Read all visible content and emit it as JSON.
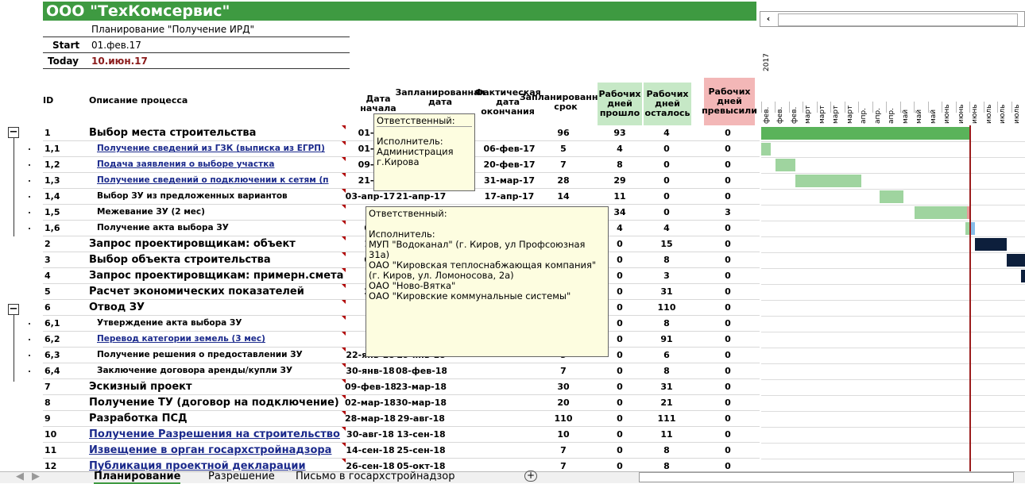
{
  "header": {
    "company": "ООО \"ТехКомсервис\"",
    "subtitle": "Планирование \"Получение ИРД\"",
    "start_label": "Start",
    "start_value": "01.фев.17",
    "today_label": "Today",
    "today_value": "10.июн.17",
    "year": "2017"
  },
  "columns": {
    "id": "ID",
    "desc": "Описание процесса",
    "start": "Дата начала",
    "plan": "Запланированная дата",
    "fact": "Фактическая дата окончания",
    "term": "Запланированный срок",
    "passed": "Рабочих дней прошло",
    "left": "Рабочих дней осталось",
    "over": "Рабочих дней превысили"
  },
  "months": [
    "фев.",
    "фев.",
    "фев.",
    "март",
    "март",
    "март",
    "март",
    "апр.",
    "апр.",
    "апр.",
    "май",
    "май",
    "май",
    "июнь",
    "июнь",
    "июнь",
    "июль",
    "июль",
    "июль"
  ],
  "rows": [
    {
      "id": "1",
      "desc": "Выбор места строительства",
      "start": "01-ф",
      "plan": "7",
      "fact": "",
      "term": "96",
      "passed": "93",
      "left": "4",
      "over": "0",
      "style": "big"
    },
    {
      "id": "1,1",
      "desc": "Получение сведений из ГЗК (выписка из ЕГРП)",
      "start": "01-ф",
      "plan": "7",
      "fact": "06-фев-17",
      "term": "5",
      "passed": "4",
      "left": "0",
      "over": "0",
      "style": "link"
    },
    {
      "id": "1,2",
      "desc": "Подача заявления о выборе участка",
      "start": "09-ф",
      "plan": "7",
      "fact": "20-фев-17",
      "term": "7",
      "passed": "8",
      "left": "0",
      "over": "0",
      "style": "link"
    },
    {
      "id": "1,3",
      "desc": "Получение сведений о подключении к сетям (п",
      "start": "21-ф",
      "plan": "7",
      "fact": "31-мар-17",
      "term": "28",
      "passed": "29",
      "left": "0",
      "over": "0",
      "style": "link"
    },
    {
      "id": "1,4",
      "desc": "Выбор ЗУ из предложенных вариантов",
      "start": "03-апр-17",
      "plan": "21-апр-17",
      "fact": "17-апр-17",
      "term": "14",
      "passed": "11",
      "left": "0",
      "over": "0",
      "style": "sub"
    },
    {
      "id": "1,5",
      "desc": "Межевание ЗУ (2 мес)",
      "start": "2",
      "plan": "",
      "fact": "",
      "term": "",
      "passed": "34",
      "left": "0",
      "over": "3",
      "style": "sub"
    },
    {
      "id": "1,6",
      "desc": "Получение акта выбора ЗУ",
      "start": "06",
      "plan": "",
      "fact": "",
      "term": "",
      "passed": "4",
      "left": "4",
      "over": "0",
      "style": "sub"
    },
    {
      "id": "2",
      "desc": "Запрос проектировщикам: объект",
      "start": "16",
      "plan": "",
      "fact": "",
      "term": "",
      "passed": "0",
      "left": "15",
      "over": "0",
      "style": "big"
    },
    {
      "id": "3",
      "desc": "Выбор объекта строительства",
      "start": "07",
      "plan": "",
      "fact": "",
      "term": "",
      "passed": "0",
      "left": "8",
      "over": "0",
      "style": "big"
    },
    {
      "id": "4",
      "desc": "Запрос проектировщикам: примерн.смета",
      "start": "1",
      "plan": "",
      "fact": "",
      "term": "",
      "passed": "0",
      "left": "3",
      "over": "0",
      "style": "big"
    },
    {
      "id": "5",
      "desc": "Расчет экономических показателей",
      "start": "24",
      "plan": "",
      "fact": "",
      "term": "",
      "passed": "0",
      "left": "31",
      "over": "0",
      "style": "big"
    },
    {
      "id": "6",
      "desc": "Отвод ЗУ",
      "start": "0",
      "plan": "",
      "fact": "",
      "term": "",
      "passed": "0",
      "left": "110",
      "over": "0",
      "style": "big"
    },
    {
      "id": "6,1",
      "desc": "Утверждение акта выбора ЗУ",
      "start": "0",
      "plan": "",
      "fact": "",
      "term": "",
      "passed": "0",
      "left": "8",
      "over": "0",
      "style": "sub"
    },
    {
      "id": "6,2",
      "desc": "Перевод категории земель (3 мес)",
      "start": "1",
      "plan": "",
      "fact": "",
      "term": "",
      "passed": "0",
      "left": "91",
      "over": "0",
      "style": "link"
    },
    {
      "id": "6,3",
      "desc": "Получение решения о предоставлении ЗУ",
      "start": "22-янв-18",
      "plan": "29-янв-18",
      "fact": "",
      "term": "5",
      "passed": "0",
      "left": "6",
      "over": "0",
      "style": "sub"
    },
    {
      "id": "6,4",
      "desc": "Заключение договора аренды/купли ЗУ",
      "start": "30-янв-18",
      "plan": "08-фев-18",
      "fact": "",
      "term": "7",
      "passed": "0",
      "left": "8",
      "over": "0",
      "style": "sub"
    },
    {
      "id": "7",
      "desc": "Эскизный проект",
      "start": "09-фев-18",
      "plan": "23-мар-18",
      "fact": "",
      "term": "30",
      "passed": "0",
      "left": "31",
      "over": "0",
      "style": "big"
    },
    {
      "id": "8",
      "desc": "Получение ТУ (договор на подключение)",
      "start": "02-мар-18",
      "plan": "30-мар-18",
      "fact": "",
      "term": "20",
      "passed": "0",
      "left": "21",
      "over": "0",
      "style": "big"
    },
    {
      "id": "9",
      "desc": "Разработка ПСД",
      "start": "28-мар-18",
      "plan": "29-авг-18",
      "fact": "",
      "term": "110",
      "passed": "0",
      "left": "111",
      "over": "0",
      "style": "big"
    },
    {
      "id": "10",
      "desc": "Получение Разрешения на строительство",
      "start": "30-авг-18",
      "plan": "13-сен-18",
      "fact": "",
      "term": "10",
      "passed": "0",
      "left": "11",
      "over": "0",
      "style": "biglink"
    },
    {
      "id": "11",
      "desc": "Извещение в орган госархстройнадзора",
      "start": "14-сен-18",
      "plan": "25-сен-18",
      "fact": "",
      "term": "7",
      "passed": "0",
      "left": "8",
      "over": "0",
      "style": "biglink"
    },
    {
      "id": "12",
      "desc": "Публикация проектной декларации",
      "start": "26-сен-18",
      "plan": "05-окт-18",
      "fact": "",
      "term": "7",
      "passed": "0",
      "left": "8",
      "over": "0",
      "style": "biglink"
    }
  ],
  "gantt_bars": [
    {
      "row": 0,
      "start": 0.0,
      "end": 0.79,
      "kind": "green"
    },
    {
      "row": 1,
      "start": 0.0,
      "end": 0.035,
      "kind": "lgreen"
    },
    {
      "row": 2,
      "start": 0.055,
      "end": 0.13,
      "kind": "lgreen"
    },
    {
      "row": 3,
      "start": 0.13,
      "end": 0.38,
      "kind": "lgreen"
    },
    {
      "row": 4,
      "start": 0.45,
      "end": 0.54,
      "kind": "lgreen"
    },
    {
      "row": 5,
      "start": 0.58,
      "end": 0.78,
      "kind": "lgreen"
    },
    {
      "row": 5,
      "start": 0.78,
      "end": 0.79,
      "kind": "pink"
    },
    {
      "row": 6,
      "start": 0.775,
      "end": 0.79,
      "kind": "lgreen"
    },
    {
      "row": 6,
      "start": 0.79,
      "end": 0.81,
      "kind": "blue"
    },
    {
      "row": 7,
      "start": 0.81,
      "end": 0.93,
      "kind": "navy"
    },
    {
      "row": 8,
      "start": 0.93,
      "end": 1.0,
      "kind": "navy"
    },
    {
      "row": 9,
      "start": 0.985,
      "end": 1.0,
      "kind": "navy"
    }
  ],
  "today_position": 0.79,
  "tooltip1": {
    "title": "Ответственный:",
    "lines": [
      "Исполнитель:",
      "Администрация",
      "г.Кирова"
    ]
  },
  "tooltip2": {
    "title": "Ответственный:",
    "lines": [
      "Исполнитель:",
      "МУП \"Водоканал\" (г. Киров, ул Профсоюзная 31а)",
      "ОАО \"Кировская теплоснабжающая компания\" (г. Киров, ул. Ломоносова, 2а)",
      "ОАО \"Ново-Вятка\"",
      "ОАО \"Кировские коммунальные системы\""
    ]
  },
  "tabs": [
    "Планирование",
    "Разрешение",
    "Письмо в госархстройнадзор"
  ],
  "add_sheet": "+",
  "colors": {
    "title_bg": "#3e9a41",
    "link": "#1b2a8c",
    "today_line": "#9b1c1c"
  }
}
